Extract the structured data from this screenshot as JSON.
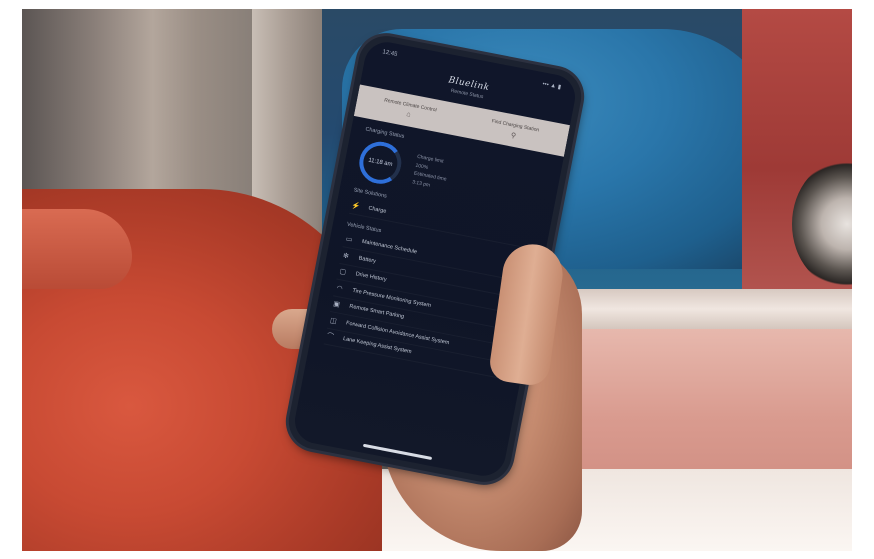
{
  "status": {
    "time": "12:45",
    "signal": "••• ▲ ▮"
  },
  "app": {
    "title": "Bluelink",
    "subtitle": "Remote Status"
  },
  "quick_actions": [
    {
      "label": "Remote Climate Control",
      "icon": "climate-icon"
    },
    {
      "label": "Find Charging Station",
      "icon": "charging-station-icon"
    }
  ],
  "charging": {
    "heading": "Charging Status",
    "ring_value": "11:18 am",
    "info": [
      "Charge limit",
      "100%",
      "Estimated time",
      "3:13 pm"
    ]
  },
  "sections": {
    "site": "Site Solutions",
    "site_item": "Charge",
    "vehicle": "Vehicle Status"
  },
  "items": [
    {
      "label": "Maintenance Schedule",
      "icon": "car-icon"
    },
    {
      "label": "Battery",
      "icon": "battery-icon"
    },
    {
      "label": "Drive History",
      "icon": "route-icon"
    },
    {
      "label": "Tire Pressure Monitoring System",
      "icon": "tire-icon"
    },
    {
      "label": "Remote Smart Parking",
      "icon": "parking-icon"
    },
    {
      "label": "Forward Collision Avoidance Assist System",
      "icon": "collision-icon"
    },
    {
      "label": "Lane Keeping Assist System",
      "icon": "lane-icon"
    }
  ]
}
